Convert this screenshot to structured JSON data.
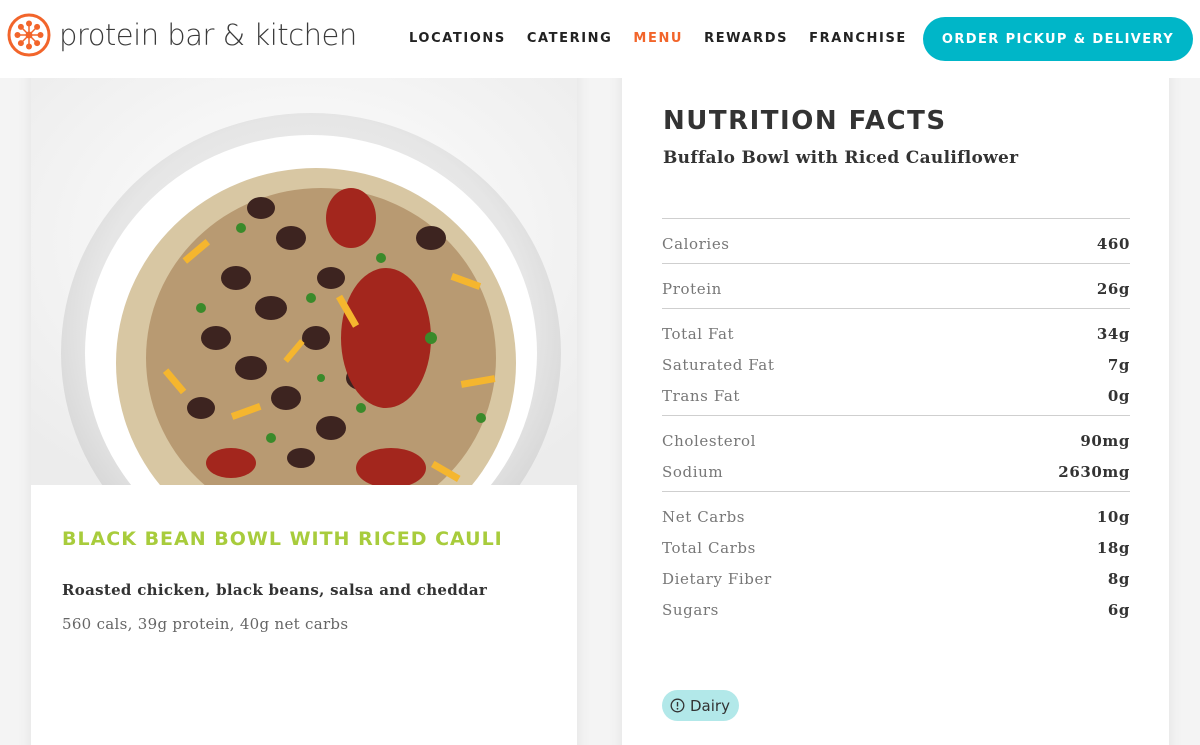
{
  "header": {
    "brand": "protein bar & kitchen",
    "nav": [
      "LOCATIONS",
      "CATERING",
      "MENU",
      "REWARDS",
      "FRANCHISE"
    ],
    "active_nav": "MENU",
    "order_button": "ORDER PICKUP & DELIVERY"
  },
  "item": {
    "title": "BLACK BEAN BOWL WITH RICED CAULI",
    "description": "Roasted chicken, black beans, salsa and cheddar",
    "stats": "560 cals, 39g protein, 40g net carbs"
  },
  "nutrition": {
    "title": "NUTRITION FACTS",
    "subtitle": "Buffalo Bowl with Riced Cauliflower",
    "groups": [
      [
        {
          "label": "Calories",
          "value": "460"
        }
      ],
      [
        {
          "label": "Protein",
          "value": "26g"
        }
      ],
      [
        {
          "label": "Total Fat",
          "value": "34g"
        },
        {
          "label": "Saturated Fat",
          "value": "7g"
        },
        {
          "label": "Trans Fat",
          "value": "0g"
        }
      ],
      [
        {
          "label": "Cholesterol",
          "value": "90mg"
        },
        {
          "label": "Sodium",
          "value": "2630mg"
        }
      ],
      [
        {
          "label": "Net Carbs",
          "value": "10g"
        },
        {
          "label": "Total Carbs",
          "value": "18g"
        },
        {
          "label": "Dietary Fiber",
          "value": "8g"
        },
        {
          "label": "Sugars",
          "value": "6g"
        }
      ]
    ],
    "allergen": "Dairy"
  },
  "colors": {
    "brand_orange": "#f2652b",
    "accent_teal": "#00b6c8",
    "title_green": "#a8cc3c",
    "allergen_bg": "#b2e8e9"
  },
  "icons": {
    "logo": "asterisk-flower-logo",
    "allergen": "info-circle-icon"
  }
}
